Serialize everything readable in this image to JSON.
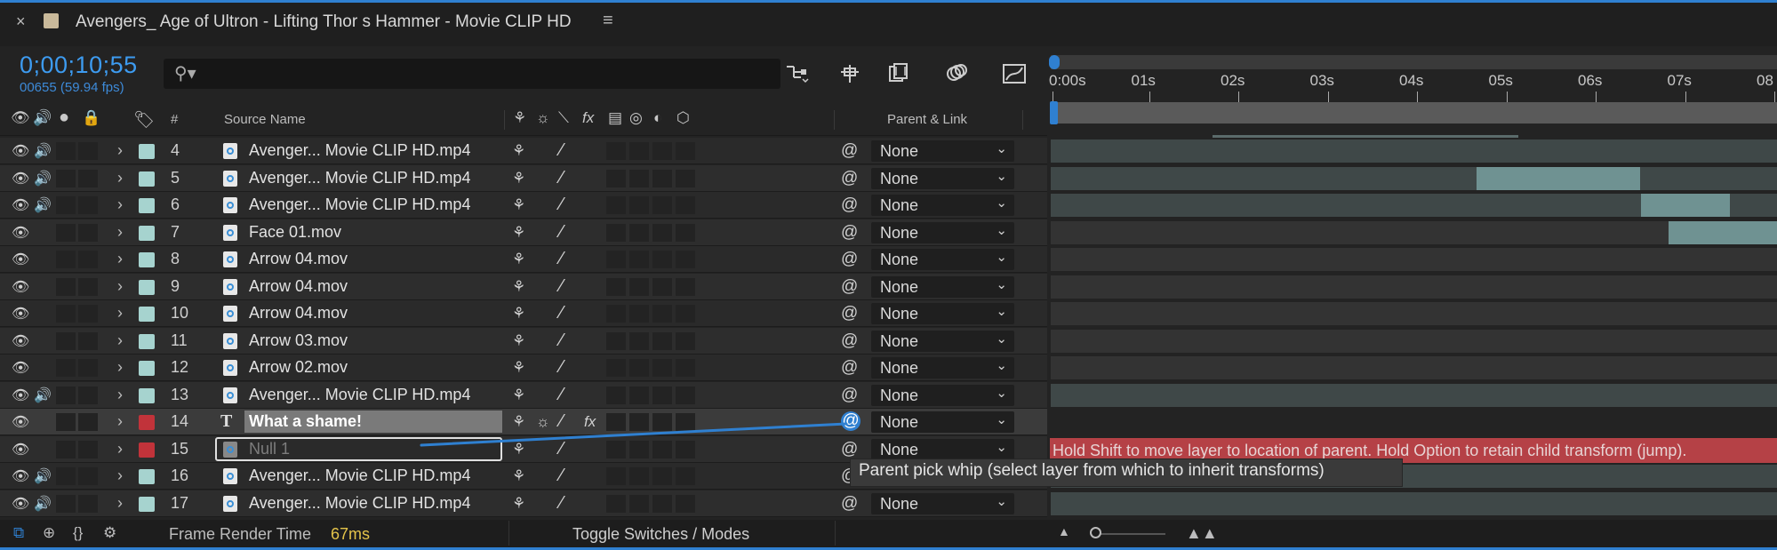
{
  "tab": {
    "close": "×",
    "title": "Avengers_ Age of Ultron - Lifting Thor s Hammer - Movie CLIP HD",
    "menu": "≡"
  },
  "timecode": "0;00;10;55",
  "frame_info": "00655 (59.94 fps)",
  "search": {
    "placeholder": ""
  },
  "toolbar_icons": [
    "composition-flowchart-icon",
    "draft-3d-icon",
    "frame-blending-icon",
    "motion-blur-icon",
    "graph-editor-icon"
  ],
  "columns": {
    "number": "#",
    "source_name": "Source Name",
    "parent_link": "Parent & Link"
  },
  "ruler": {
    "labels": [
      "0:00s",
      "01s",
      "02s",
      "03s",
      "04s",
      "05s",
      "06s",
      "07s",
      "08"
    ]
  },
  "layers": [
    {
      "num": "4",
      "name": "Avenger... Movie CLIP HD.mp4",
      "audio": true,
      "color": "#a6d3cf",
      "type": "footage",
      "parent": "None"
    },
    {
      "num": "5",
      "name": "Avenger... Movie CLIP HD.mp4",
      "audio": true,
      "color": "#a6d3cf",
      "type": "footage",
      "parent": "None"
    },
    {
      "num": "6",
      "name": "Avenger... Movie CLIP HD.mp4",
      "audio": true,
      "color": "#a6d3cf",
      "type": "footage",
      "parent": "None"
    },
    {
      "num": "7",
      "name": "Face 01.mov",
      "audio": false,
      "color": "#a6d3cf",
      "type": "footage",
      "parent": "None"
    },
    {
      "num": "8",
      "name": "Arrow 04.mov",
      "audio": false,
      "color": "#a6d3cf",
      "type": "footage",
      "parent": "None"
    },
    {
      "num": "9",
      "name": "Arrow 04.mov",
      "audio": false,
      "color": "#a6d3cf",
      "type": "footage",
      "parent": "None"
    },
    {
      "num": "10",
      "name": "Arrow 04.mov",
      "audio": false,
      "color": "#a6d3cf",
      "type": "footage",
      "parent": "None"
    },
    {
      "num": "11",
      "name": "Arrow 03.mov",
      "audio": false,
      "color": "#a6d3cf",
      "type": "footage",
      "parent": "None"
    },
    {
      "num": "12",
      "name": "Arrow 02.mov",
      "audio": false,
      "color": "#a6d3cf",
      "type": "footage",
      "parent": "None"
    },
    {
      "num": "13",
      "name": "Avenger... Movie CLIP HD.mp4",
      "audio": true,
      "color": "#a6d3cf",
      "type": "footage",
      "parent": "None"
    },
    {
      "num": "14",
      "name": "What a shame!",
      "audio": false,
      "color": "#c1333a",
      "type": "text",
      "parent": "None"
    },
    {
      "num": "15",
      "name": "Null 1",
      "audio": false,
      "color": "#c1333a",
      "type": "null",
      "parent": "None"
    },
    {
      "num": "16",
      "name": "Avenger... Movie CLIP HD.mp4",
      "audio": true,
      "color": "#a6d3cf",
      "type": "footage",
      "parent": ""
    },
    {
      "num": "17",
      "name": "Avenger... Movie CLIP HD.mp4",
      "audio": true,
      "color": "#a6d3cf",
      "type": "footage",
      "parent": "None"
    }
  ],
  "hint_bar": "Hold Shift to move layer to location of parent. Hold Option to retain child transform (jump).",
  "tooltip": "Parent pick whip (select layer from which to inherit transforms)",
  "bottom": {
    "render_label": "Frame Render Time",
    "render_value": "67ms",
    "toggle": "Toggle Switches / Modes"
  },
  "colors": {
    "accent": "#2f80d1",
    "timecode": "#3d9bf0",
    "label_aqua": "#a6d3cf",
    "label_red": "#c1333a",
    "render_value": "#e3c34a",
    "hint_red": "#b54146"
  }
}
